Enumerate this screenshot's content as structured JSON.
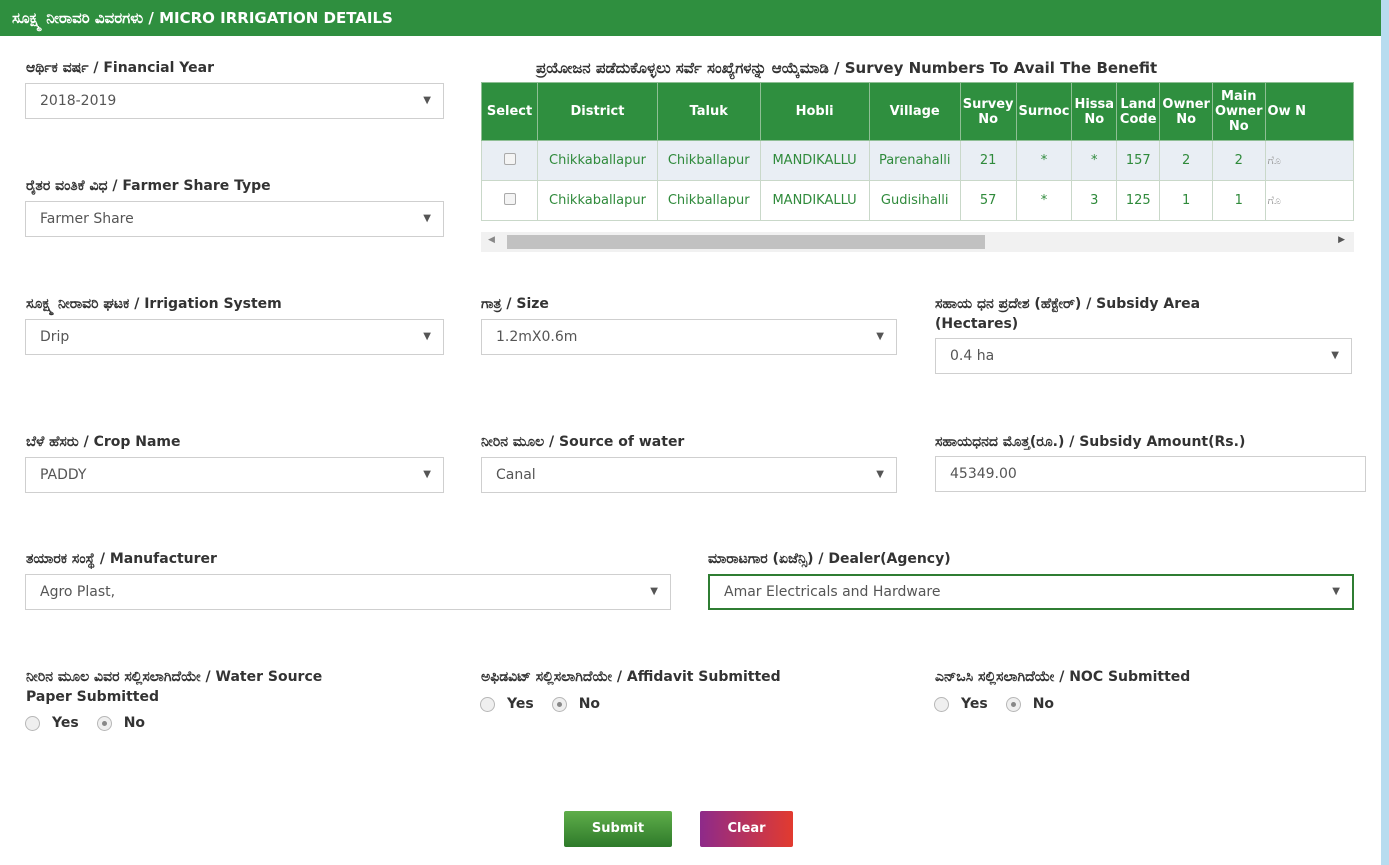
{
  "header": {
    "title": "ಸೂಕ್ಷ್ಮ ನೀರಾವರಿ ವಿವರಗಳು / MICRO IRRIGATION DETAILS"
  },
  "financial_year": {
    "label": "ಆರ್ಥಿಕ ವರ್ಷ / Financial Year",
    "value": "2018-2019"
  },
  "farmer_share_type": {
    "label": "ರೈತರ ವಂತಿಕೆ ವಿಧ / Farmer Share Type",
    "value": "Farmer Share"
  },
  "survey": {
    "title": "ಪ್ರಯೋಜನ ಪಡೆದುಕೊಳ್ಳಲು ಸರ್ವೆ ಸಂಖ್ಯೆಗಳನ್ನು ಆಯ್ಕೆಮಾಡಿ / Survey Numbers To Avail The Benefit",
    "columns": [
      "Select",
      "District",
      "Taluk",
      "Hobli",
      "Village",
      "Survey No",
      "Surnoc",
      "Hissa No",
      "Land Code",
      "Owner No",
      "Main Owner No",
      "Ow N"
    ],
    "rows": [
      {
        "district": "Chikkaballapur",
        "taluk": "Chikballapur",
        "hobli": "MANDIKALLU",
        "village": "Parenahalli",
        "survey_no": "21",
        "surnoc": "*",
        "hissa_no": "*",
        "land_code": "157",
        "owner_no": "2",
        "main_owner_no": "2",
        "owner_name": "ಗೊ"
      },
      {
        "district": "Chikkaballapur",
        "taluk": "Chikballapur",
        "hobli": "MANDIKALLU",
        "village": "Gudisihalli",
        "survey_no": "57",
        "surnoc": "*",
        "hissa_no": "3",
        "land_code": "125",
        "owner_no": "1",
        "main_owner_no": "1",
        "owner_name": "ಗೊ"
      }
    ]
  },
  "irrigation_system": {
    "label": "ಸೂಕ್ಷ್ಮ ನೀರಾವರಿ ಘಟಕ / Irrigation System",
    "value": "Drip"
  },
  "size": {
    "label": "ಗಾತ್ರ / Size",
    "value": "1.2mX0.6m"
  },
  "subsidy_area": {
    "label_line1": "ಸಹಾಯ ಧನ ಪ್ರದೇಶ (ಹೆಕ್ಟೇರ್) / Subsidy Area",
    "label_line2": "(Hectares)",
    "value": "0.4 ha"
  },
  "crop_name": {
    "label": "ಬೆಳೆ ಹೆಸರು / Crop Name",
    "value": "PADDY"
  },
  "source_of_water": {
    "label": "ನೀರಿನ ಮೂಲ / Source of water",
    "value": "Canal"
  },
  "subsidy_amount": {
    "label": "ಸಹಾಯಧನದ ಮೊತ್ತ(ರೂ.) / Subsidy Amount(Rs.)",
    "value": "45349.00"
  },
  "manufacturer": {
    "label": "ತಯಾರಕ ಸಂಸ್ಥೆ / Manufacturer",
    "value": "Agro Plast,"
  },
  "dealer": {
    "label": "ಮಾರಾಟಗಾರ (ಏಜೆನ್ಸಿ) / Dealer(Agency)",
    "value": "Amar Electricals and Hardware"
  },
  "water_source_paper": {
    "label_line1": "ನೀರಿನ ಮೂಲ ವಿವರ ಸಲ್ಲಿಸಲಾಗಿದೆಯೇ / Water Source",
    "label_line2": "Paper Submitted",
    "yes": "Yes",
    "no": "No",
    "selected": "No"
  },
  "affidavit": {
    "label": "ಅಫಿಡವಿಟ್ ಸಲ್ಲಿಸಲಾಗಿದೆಯೇ / Affidavit Submitted",
    "yes": "Yes",
    "no": "No",
    "selected": "No"
  },
  "noc": {
    "label": "ಎನ್‌ಒಸಿ ಸಲ್ಲಿಸಲಾಗಿದೆಯೇ / NOC Submitted",
    "yes": "Yes",
    "no": "No",
    "selected": "No"
  },
  "buttons": {
    "submit": "Submit",
    "clear": "Clear"
  },
  "icons": {
    "caret": "▼",
    "scroll_left": "◀",
    "scroll_right": "▶"
  }
}
